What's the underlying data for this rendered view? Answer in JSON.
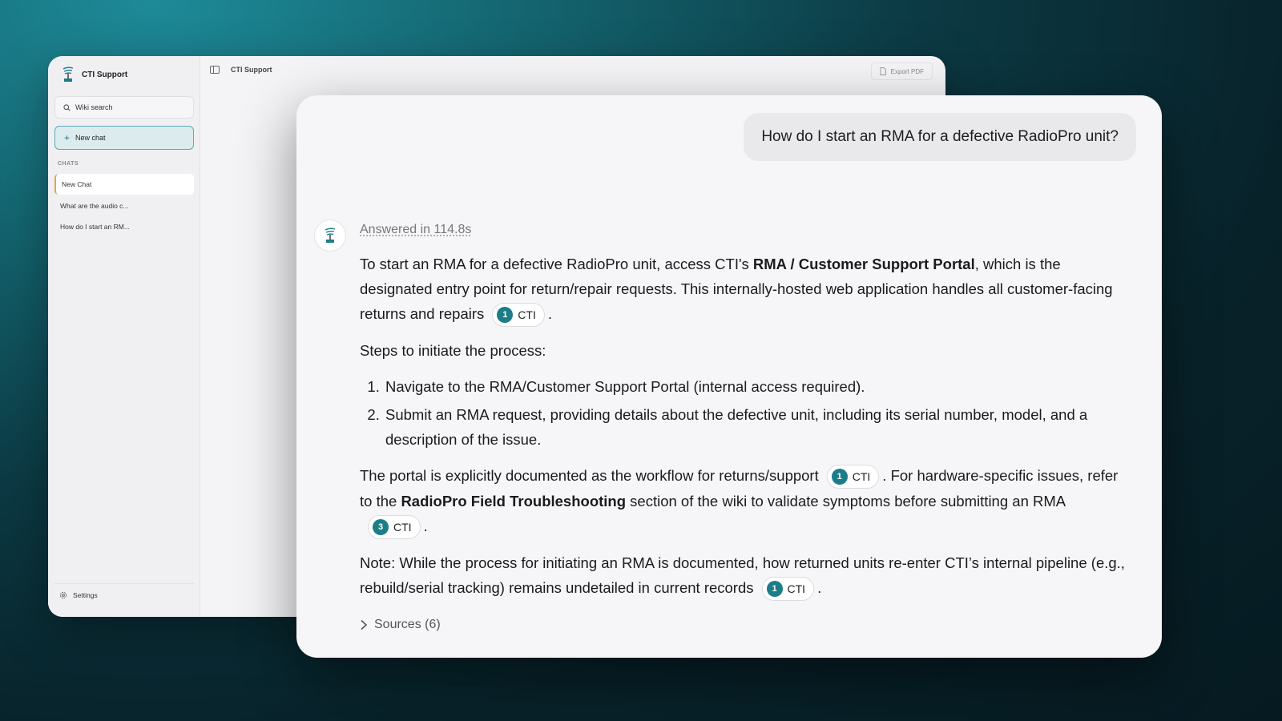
{
  "app": {
    "brand_title": "CTI Support",
    "accent_color": "#1b7d87"
  },
  "sidebar": {
    "search_label": "Wiki search",
    "new_chat_label": "New chat",
    "chats_header": "CHATS",
    "chats": [
      {
        "label": "New Chat",
        "active": true
      },
      {
        "label": "What are the audio c...",
        "active": false
      },
      {
        "label": "How do I start an RM...",
        "active": false
      }
    ],
    "settings_label": "Settings"
  },
  "topbar": {
    "title": "CTI Support",
    "export_label": "Export PDF"
  },
  "conversation": {
    "user_message": "How do I start an RMA for a defective RadioPro unit?",
    "answered_in": "Answered in 114.8s",
    "para1_a": "To start an RMA for a defective RadioPro unit, access CTI's ",
    "para1_bold": "RMA / Customer Support Portal",
    "para1_b": ", which is the designated entry point for return/repair requests. This internally-hosted web application handles all customer-facing returns and repairs",
    "steps_intro": "Steps to initiate the process:",
    "steps": [
      "Navigate to the RMA/Customer Support Portal (internal access required).",
      "Submit an RMA request, providing details about the defective unit, including its serial number, model, and a description of the issue."
    ],
    "para3_a": "The portal is explicitly documented as the workflow for returns/support",
    "para3_b": ". For hardware-specific issues, refer to the ",
    "para3_bold": "RadioPro Field Troubleshooting",
    "para3_c": " section of the wiki to validate symptoms before submitting an RMA",
    "para4": "Note: While the process for initiating an RMA is documented, how returned units re-enter CTI’s internal pipeline (e.g., rebuild/serial tracking) remains undetailed in current records",
    "period": ".",
    "citations": {
      "c1": {
        "num": "1",
        "label": "CTI"
      },
      "c3": {
        "num": "3",
        "label": "CTI"
      }
    },
    "sources_label": "Sources (6)"
  }
}
